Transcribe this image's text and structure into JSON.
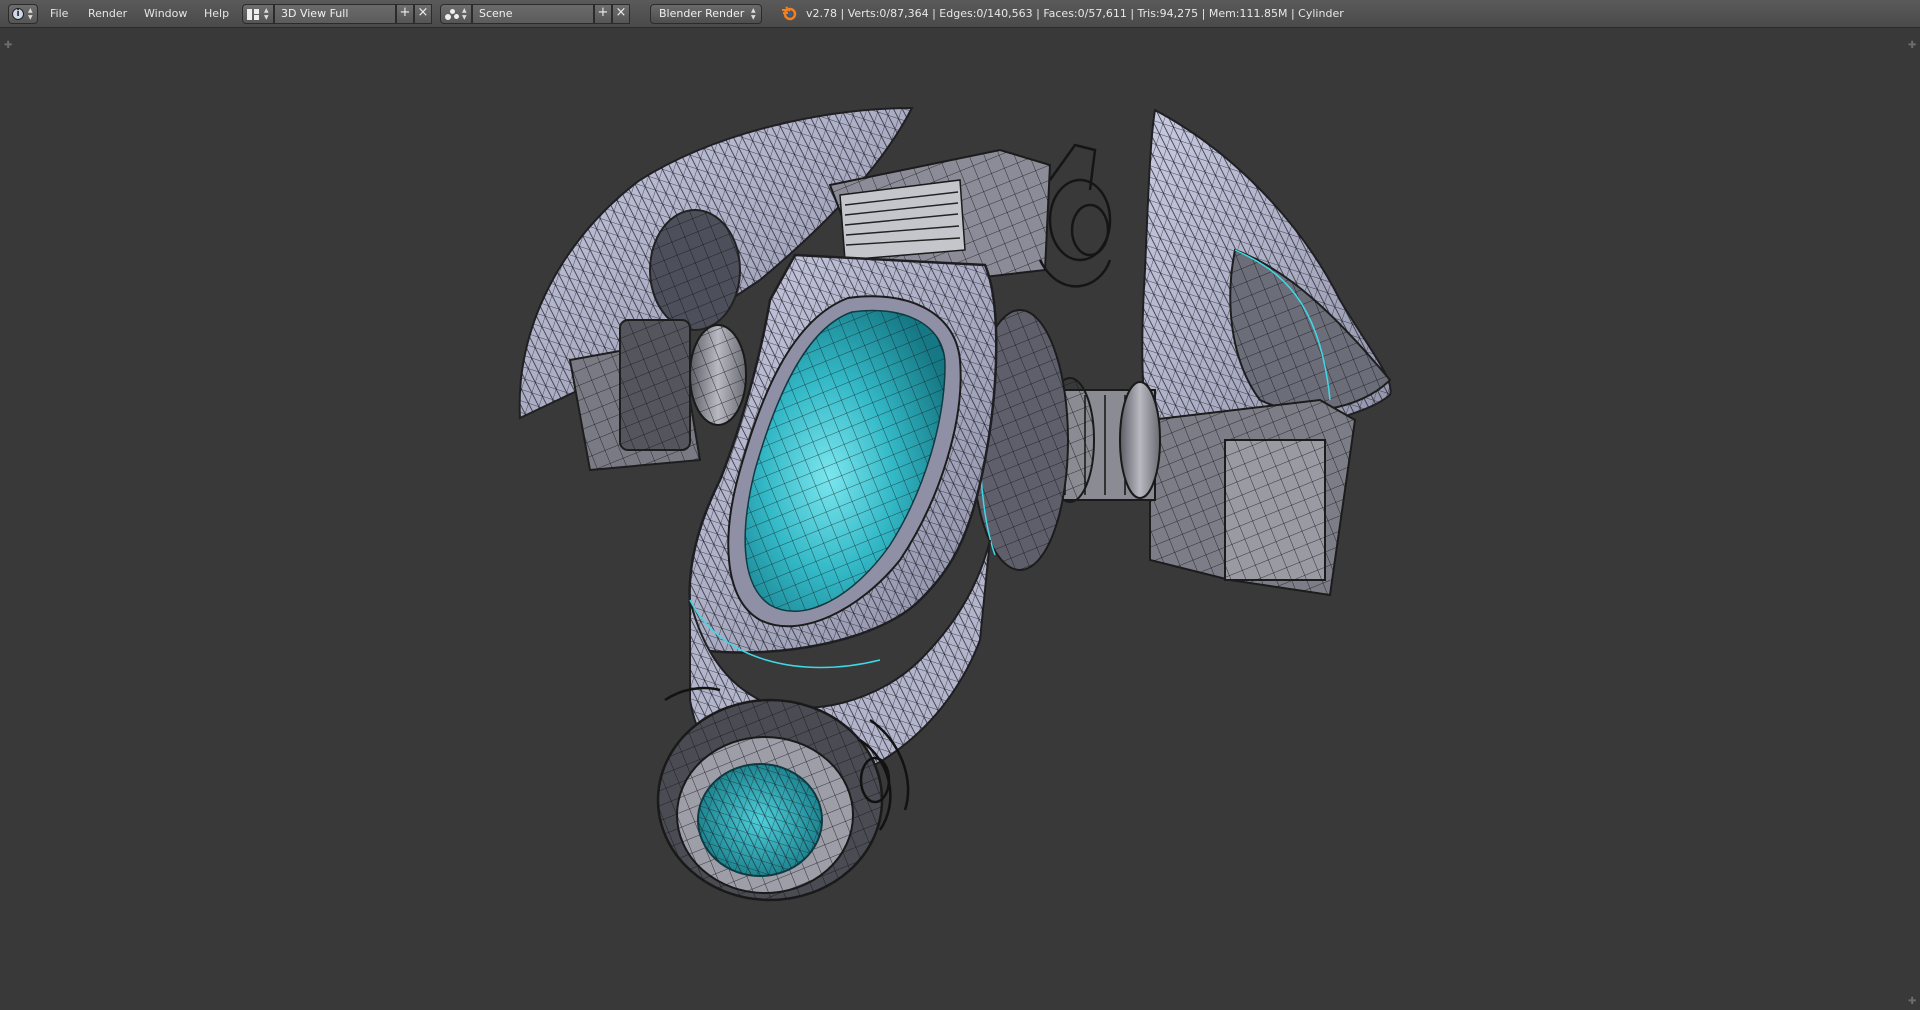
{
  "header": {
    "editor_type_icon": "info-icon",
    "menus": [
      "File",
      "Render",
      "Window",
      "Help"
    ],
    "screen_layout": {
      "icon": "layout-grid-icon",
      "value": "3D View Full"
    },
    "scene": {
      "icon": "scene-icon",
      "value": "Scene"
    },
    "add_icon": "plus-icon",
    "close_icon": "x-icon",
    "render_engine": "Blender Render",
    "logo_icon": "blender-logo-icon",
    "stats": "v2.78 | Verts:0/87,364 | Edges:0/140,563 | Faces:0/57,611 | Tris:94,275 | Mem:111.85M | Cylinder"
  },
  "viewport": {
    "background": "#393939",
    "object_name": "Cylinder",
    "colors": {
      "hull": "#b4b6d4",
      "hull_dark": "#6a6c78",
      "metal": "#9a9aa2",
      "canopy": "#2fb2c2",
      "canopy_light": "#6fe0ea",
      "wire": "#1a1a1a",
      "accent": "#3fd8e6"
    }
  }
}
